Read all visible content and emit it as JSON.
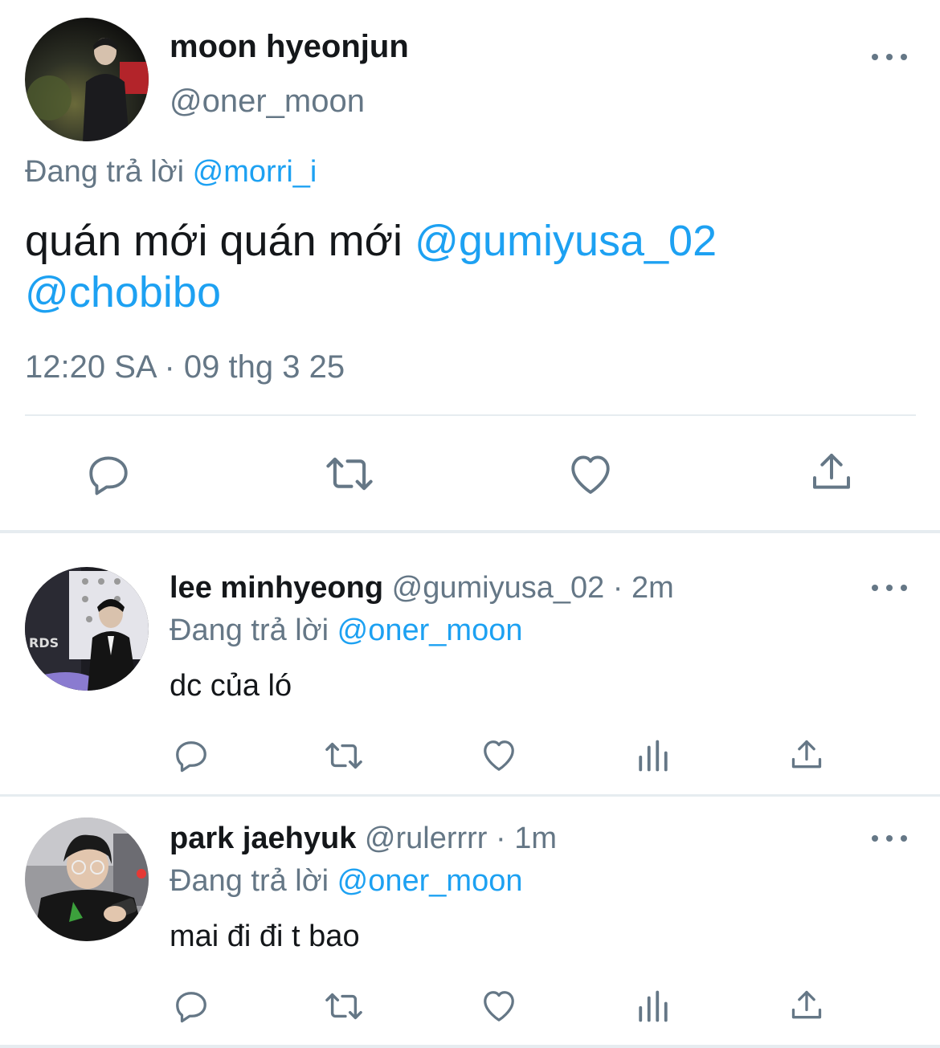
{
  "main_tweet": {
    "author_name": "moon hyeonjun",
    "author_handle": "@oner_moon",
    "replying_label": "Đang trả lời",
    "replying_to": "@morri_i",
    "text_plain": "quán mới quán mới",
    "mention_1": "@gumiyusa_02",
    "mention_2": "@chobibo",
    "timestamp": "12:20 SA · 09 thg 3 25",
    "actions": [
      "reply-icon",
      "retweet-icon",
      "like-icon",
      "share-icon"
    ]
  },
  "replies": [
    {
      "author_name": "lee minhyeong",
      "author_handle": "@gumiyusa_02",
      "time": "· 2m",
      "replying_label": "Đang trả lời",
      "replying_to": "@oner_moon",
      "text": "dc của ló",
      "actions": [
        "reply-icon",
        "retweet-icon",
        "like-icon",
        "analytics-icon",
        "share-icon"
      ]
    },
    {
      "author_name": "park jaehyuk",
      "author_handle": "@rulerrrr",
      "time": "· 1m",
      "replying_label": "Đang trả lời",
      "replying_to": "@oner_moon",
      "text": "mai đi đi t bao",
      "actions": [
        "reply-icon",
        "retweet-icon",
        "like-icon",
        "analytics-icon",
        "share-icon"
      ]
    }
  ],
  "colors": {
    "accent": "#1da1f2",
    "muted": "#657786",
    "text": "#14171a",
    "divider": "#e6ecf0"
  }
}
